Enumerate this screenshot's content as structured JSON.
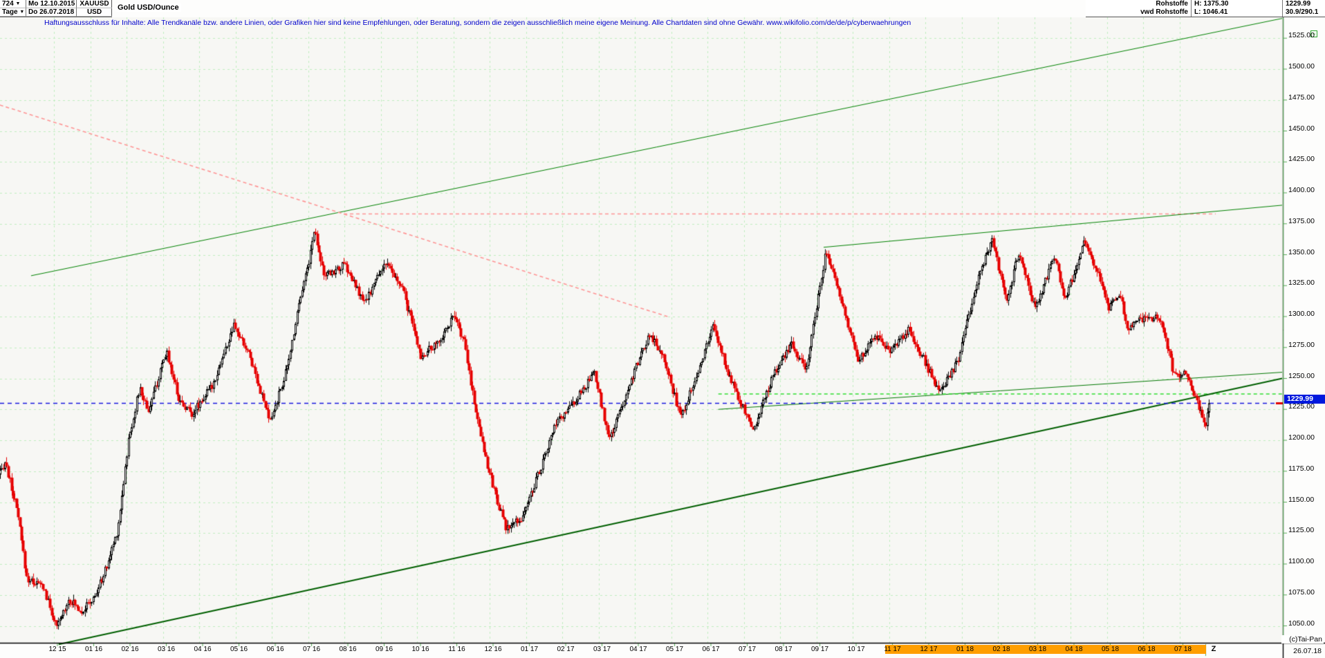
{
  "header": {
    "periods_count": "724",
    "timeframe": "Tage",
    "dropdown_icon": "▼",
    "date_from": "Mo 12.10.2015",
    "date_to": "Do 26.07.2018",
    "symbol": "XAUUSD",
    "currency": "USD",
    "instrument_name": "Gold USD/Ounce"
  },
  "info_panel": {
    "category": "Rohstoffe",
    "provider": "vwd Rohstoffe",
    "high_label": "H: 1375.30",
    "low_label": "L: 1046.41",
    "last_price": "1229.99",
    "stat_value": "30.9/290.1"
  },
  "disclaimer": "Haftungsausschluss für Inhalte: Alle Trendkanäle bzw. andere Linien, oder Grafiken hier sind keine Empfehlungen, oder Beratung, sondern die zeigen ausschließlich meine eigene Meinung. Alle Chartdaten sind ohne Gewähr.  www.wikifolio.com/de/de/p/cyberwaehrungen",
  "price_axis": {
    "ticks": [
      "1525.00",
      "1500.00",
      "1475.00",
      "1450.00",
      "1425.00",
      "1400.00",
      "1375.00",
      "1350.00",
      "1325.00",
      "1300.00",
      "1275.00",
      "1250.00",
      "1225.00",
      "1200.00",
      "1175.00",
      "1150.00",
      "1125.00",
      "1100.00",
      "1075.00",
      "1050.00"
    ],
    "last_price_label": "1229.99",
    "collapse_icon": "−"
  },
  "time_axis": {
    "labels": [
      "12 15",
      "01 16",
      "02 16",
      "03 16",
      "04 16",
      "05 16",
      "06 16",
      "07 16",
      "08 16",
      "09 16",
      "10 16",
      "11 16",
      "12 16",
      "01 17",
      "02 17",
      "03 17",
      "04 17",
      "05 17",
      "06 17",
      "07 17",
      "08 17",
      "09 17",
      "10 17",
      "11 17",
      "12 17",
      "01 18",
      "02 18",
      "03 18",
      "04 18",
      "05 18",
      "06 18",
      "07 18"
    ],
    "highlight_from_label": "11 17",
    "highlight_to_label": "07 18",
    "zoom_label": "Z",
    "end_date": "26.07.18"
  },
  "footer": {
    "copyright": "(c)Tai-Pan"
  },
  "colors": {
    "up_candle": "#000000",
    "down_candle": "#e60000",
    "grid": "#bfeebf",
    "axis_green": "#55aa55",
    "current_price_flag_bg": "#0018dd",
    "highlight_orange": "#ff9e00",
    "disclaimer_text": "#0000cc"
  },
  "chart_data": {
    "type": "candlestick",
    "instrument": "XAUUSD Gold USD/Ounce",
    "timeframe": "Tage (daily)",
    "range_shown": "12.10.2015 – 26.07.2018",
    "bars_count": 724,
    "current_price": 1229.99,
    "visible_high": 1375.3,
    "visible_low": 1046.41,
    "y_axis": {
      "min": 1050,
      "max": 1525,
      "step": 25,
      "unit": "USD/Ounce"
    },
    "grid": "dashed light-green, monthly vertical / 25-USD horizontal",
    "price_anchors_month_price": [
      [
        -1.63,
        1164
      ],
      [
        -1.35,
        1183
      ],
      [
        -1.0,
        1140
      ],
      [
        -0.75,
        1088
      ],
      [
        -0.3,
        1082
      ],
      [
        0.07,
        1048
      ],
      [
        0.4,
        1072
      ],
      [
        0.75,
        1062
      ],
      [
        1.1,
        1072
      ],
      [
        1.45,
        1098
      ],
      [
        1.75,
        1128
      ],
      [
        2.05,
        1200
      ],
      [
        2.35,
        1242
      ],
      [
        2.6,
        1224
      ],
      [
        3.1,
        1272
      ],
      [
        3.45,
        1232
      ],
      [
        3.8,
        1222
      ],
      [
        4.35,
        1244
      ],
      [
        4.95,
        1292
      ],
      [
        5.4,
        1268
      ],
      [
        5.95,
        1214
      ],
      [
        6.45,
        1262
      ],
      [
        6.78,
        1318
      ],
      [
        7.0,
        1342
      ],
      [
        7.17,
        1371
      ],
      [
        7.45,
        1332
      ],
      [
        8.0,
        1342
      ],
      [
        8.55,
        1310
      ],
      [
        9.1,
        1344
      ],
      [
        9.6,
        1322
      ],
      [
        10.1,
        1268
      ],
      [
        10.55,
        1278
      ],
      [
        11.0,
        1300
      ],
      [
        11.28,
        1282
      ],
      [
        11.6,
        1226
      ],
      [
        12.0,
        1172
      ],
      [
        12.45,
        1128
      ],
      [
        12.9,
        1138
      ],
      [
        13.5,
        1186
      ],
      [
        13.8,
        1212
      ],
      [
        14.3,
        1230
      ],
      [
        14.88,
        1254
      ],
      [
        15.3,
        1200
      ],
      [
        15.85,
        1246
      ],
      [
        16.4,
        1286
      ],
      [
        16.8,
        1268
      ],
      [
        17.25,
        1218
      ],
      [
        17.8,
        1262
      ],
      [
        18.15,
        1292
      ],
      [
        18.6,
        1252
      ],
      [
        19.25,
        1208
      ],
      [
        19.8,
        1252
      ],
      [
        20.3,
        1278
      ],
      [
        20.7,
        1256
      ],
      [
        21.25,
        1352
      ],
      [
        21.6,
        1322
      ],
      [
        22.15,
        1264
      ],
      [
        22.6,
        1286
      ],
      [
        23.0,
        1272
      ],
      [
        23.55,
        1290
      ],
      [
        24.4,
        1238
      ],
      [
        24.9,
        1264
      ],
      [
        25.35,
        1322
      ],
      [
        25.83,
        1362
      ],
      [
        26.25,
        1310
      ],
      [
        26.55,
        1352
      ],
      [
        27.03,
        1306
      ],
      [
        27.55,
        1350
      ],
      [
        27.85,
        1314
      ],
      [
        28.37,
        1360
      ],
      [
        28.75,
        1336
      ],
      [
        29.05,
        1306
      ],
      [
        29.35,
        1320
      ],
      [
        29.55,
        1290
      ],
      [
        29.95,
        1298
      ],
      [
        30.45,
        1300
      ],
      [
        30.85,
        1252
      ],
      [
        31.2,
        1254
      ],
      [
        31.55,
        1224
      ],
      [
        31.72,
        1214
      ],
      [
        31.84,
        1228
      ]
    ],
    "trendlines": [
      {
        "name": "upper-channel-green",
        "color": "#008200",
        "width": 1,
        "dash": null,
        "from": [
          -0.63,
          1333
        ],
        "to": [
          33.9,
          1541
        ]
      },
      {
        "name": "downtrend-dotted-red",
        "color": "#ff9494",
        "width": 1.6,
        "dash": [
          5,
          4
        ],
        "from": [
          -1.49,
          1471
        ],
        "to": [
          16.9,
          1300
        ]
      },
      {
        "name": "peak-horizontal-dotted-red",
        "color": "#ff9494",
        "width": 1.4,
        "dash": [
          5,
          4
        ],
        "from": [
          7.98,
          1383
        ],
        "to": [
          32.0,
          1383
        ]
      },
      {
        "name": "wedge-top-green",
        "color": "#008200",
        "width": 1,
        "dash": null,
        "from": [
          21.2,
          1356
        ],
        "to": [
          33.9,
          1390
        ]
      },
      {
        "name": "wedge-bottom-green",
        "color": "#007700",
        "width": 1,
        "dash": null,
        "from": [
          18.3,
          1225
        ],
        "to": [
          35.0,
          1255
        ]
      },
      {
        "name": "support-dashed-bright-green",
        "color": "#2ede2e",
        "width": 1.5,
        "dash": [
          5,
          4
        ],
        "from": [
          18.3,
          1237.4
        ],
        "to": [
          35.0,
          1237.4
        ]
      },
      {
        "name": "long-support-thick-green",
        "color": "#005f00",
        "width": 2,
        "dash": null,
        "from": [
          0.13,
          1035
        ],
        "to": [
          35.0,
          1250
        ]
      }
    ],
    "current_price_line": {
      "color": "#1414dd",
      "dash": [
        6,
        5
      ],
      "price": 1229.99
    }
  }
}
